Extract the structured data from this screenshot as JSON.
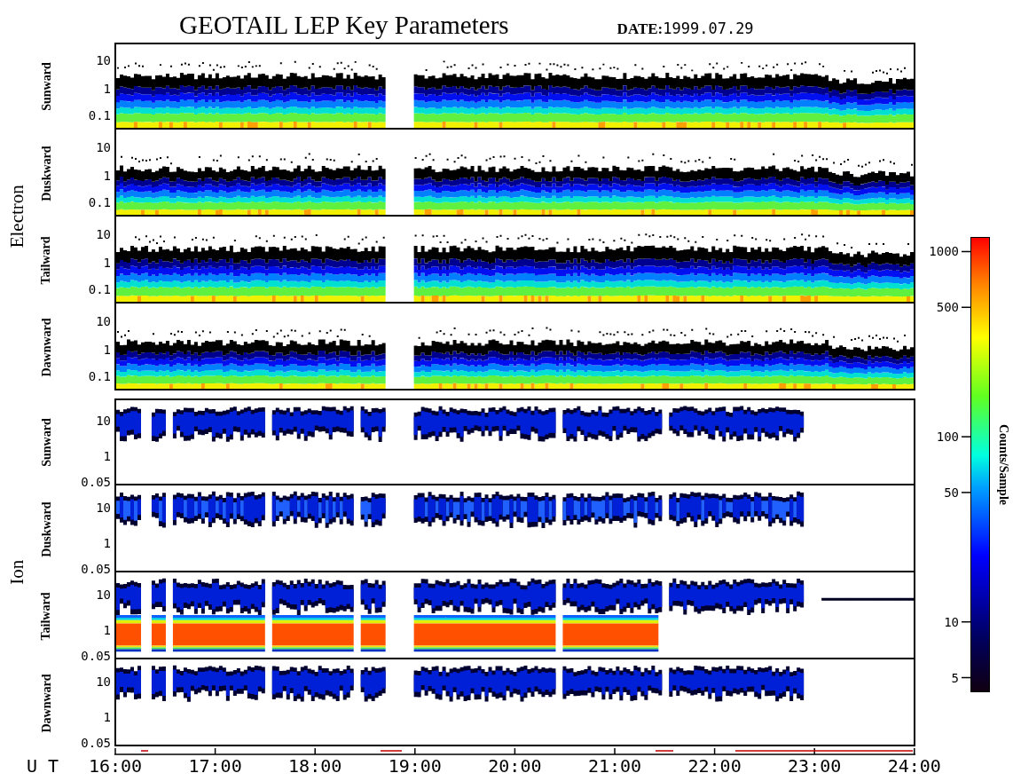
{
  "title": "GEOTAIL LEP Key Parameters",
  "date": {
    "label": "DATE:",
    "value": "1999.07.29"
  },
  "groups": [
    {
      "name": "Electron",
      "panels": [
        {
          "label": "Sunward",
          "kind": "electron",
          "yticks": [
            "10",
            "1",
            "0.1"
          ]
        },
        {
          "label": "Duskward",
          "kind": "electron",
          "yticks": [
            "10",
            "1",
            "0.1"
          ]
        },
        {
          "label": "Tailward",
          "kind": "electron",
          "yticks": [
            "10",
            "1",
            "0.1"
          ]
        },
        {
          "label": "Dawnward",
          "kind": "electron",
          "yticks": [
            "10",
            "1",
            "0.1"
          ]
        }
      ]
    },
    {
      "name": "Ion",
      "panels": [
        {
          "label": "Sunward",
          "kind": "ion",
          "yticks": [
            "10",
            "1",
            "0.05"
          ]
        },
        {
          "label": "Duskward",
          "kind": "ion",
          "yticks": [
            "10",
            "1",
            "0.05"
          ]
        },
        {
          "label": "Tailward",
          "kind": "ion-beam",
          "yticks": [
            "10",
            "1",
            "0.05"
          ]
        },
        {
          "label": "Dawnward",
          "kind": "ion",
          "yticks": [
            "10",
            "1",
            "0.05"
          ]
        }
      ]
    }
  ],
  "time_axis": {
    "label": "U T",
    "ticks": [
      "16:00",
      "17:00",
      "18:00",
      "19:00",
      "20:00",
      "21:00",
      "22:00",
      "23:00",
      "24:00"
    ]
  },
  "colorbar": {
    "title": "Counts/Sample",
    "ticks": [
      "1000",
      "500",
      "100",
      "50",
      "10",
      "5"
    ]
  }
}
